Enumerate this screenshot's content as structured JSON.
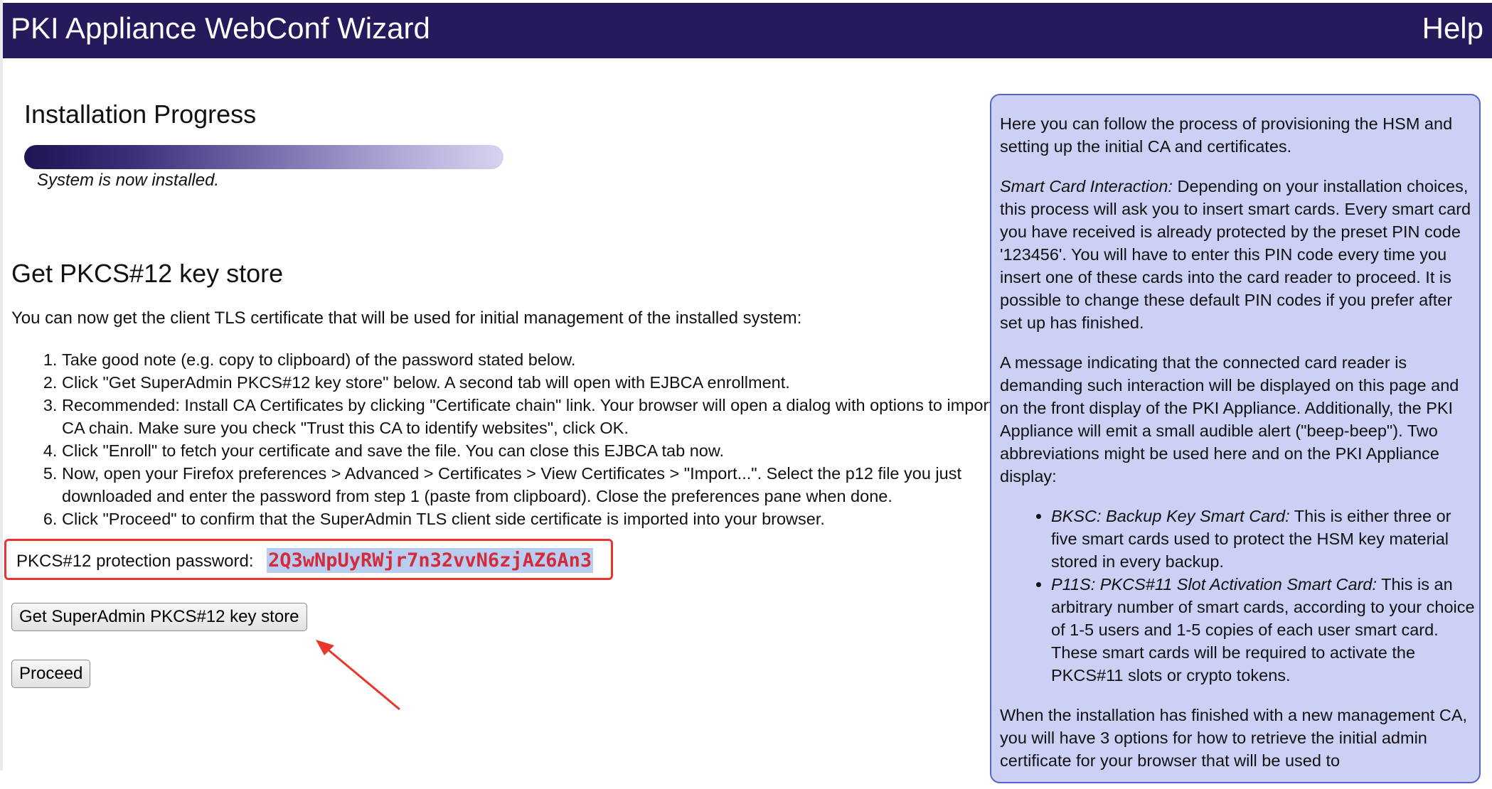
{
  "header": {
    "title": "PKI Appliance WebConf Wizard",
    "help_label": "Help",
    "bg_color": "#261a5c"
  },
  "progress": {
    "heading": "Installation Progress",
    "status": "System is now installed.",
    "fraction_complete": 1.0
  },
  "pkcs": {
    "heading": "Get PKCS#12 key store",
    "intro": "You can now get the client TLS certificate that will be used for initial management of the installed system:",
    "steps": [
      "Take good note (e.g. copy to clipboard) of the password stated below.",
      "Click \"Get SuperAdmin PKCS#12 key store\" below. A second tab will open with EJBCA enrollment.",
      "Recommended: Install CA Certificates by clicking \"Certificate chain\" link. Your browser will open a dialog with options to import the CA chain. Make sure you check \"Trust this CA to identify websites\", click OK.",
      "Click \"Enroll\" to fetch your certificate and save the file. You can close this EJBCA tab now.",
      "Now, open your Firefox preferences > Advanced > Certificates > View Certificates > \"Import...\". Select the p12 file you just downloaded and enter the password from step 1 (paste from clipboard). Close the preferences pane when done.",
      "Click \"Proceed\" to confirm that the SuperAdmin TLS client side certificate is imported into your browser."
    ],
    "password_label": "PKCS#12 protection password:",
    "password_value": "2Q3wNpUyRWjr7n32vvN6zjAZ6An3",
    "get_button": "Get SuperAdmin PKCS#12 key store",
    "proceed_button": "Proceed"
  },
  "help_panel": {
    "p1": "Here you can follow the process of provisioning the HSM and setting up the initial CA and certificates.",
    "p2_em": "Smart Card Interaction:",
    "p2_rest": " Depending on your installation choices, this process will ask you to insert smart cards. Every smart card you have received is already protected by the preset PIN code '123456'. You will have to enter this PIN code every time you insert one of these cards into the card reader to proceed. It is possible to change these default PIN codes if you prefer after set up has finished.",
    "p3": "A message indicating that the connected card reader is demanding such interaction will be displayed on this page and on the front display of the PKI Appliance. Additionally, the PKI Appliance will emit a small audible alert (\"beep-beep\"). Two abbreviations might be used here and on the PKI Appliance display:",
    "items": [
      {
        "em": "BKSC: Backup Key Smart Card:",
        "rest": " This is either three or five smart cards used to protect the HSM key material stored in every backup."
      },
      {
        "em": "P11S: PKCS#11 Slot Activation Smart Card:",
        "rest": " This is an arbitrary number of smart cards, according to your choice of 1-5 users and 1-5 copies of each user smart card. These smart cards will be required to activate the PKCS#11 slots or crypto tokens."
      }
    ],
    "p4": "When the installation has finished with a new management CA, you will have 3 options for how to retrieve the initial admin certificate for your browser that will be used to",
    "bg_color": "#ccd0f5",
    "border_color": "#5566c7"
  },
  "annotation": {
    "highlight_color": "#e8362a"
  }
}
